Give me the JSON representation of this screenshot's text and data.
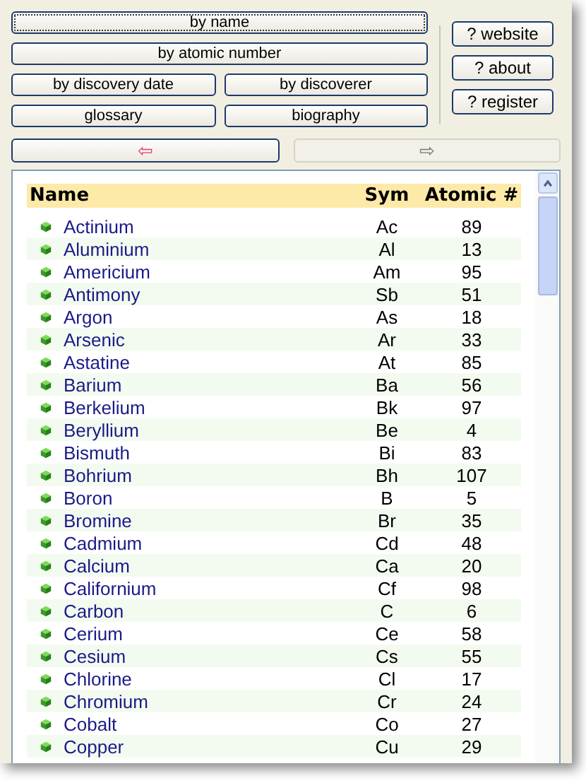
{
  "sort_buttons": [
    {
      "label": "by name",
      "selected": true,
      "wide": true
    },
    {
      "label": "by atomic number",
      "selected": false,
      "wide": true
    },
    {
      "label": "by discovery date",
      "selected": false,
      "wide": false
    },
    {
      "label": "by discoverer",
      "selected": false,
      "wide": false
    },
    {
      "label": "glossary",
      "selected": false,
      "wide": false
    },
    {
      "label": "biography",
      "selected": false,
      "wide": false
    }
  ],
  "help_buttons": [
    "? website",
    "? about",
    "? register"
  ],
  "nav": [
    {
      "label": "⇦",
      "disabled": false
    },
    {
      "label": "⇨",
      "disabled": true
    }
  ],
  "table": {
    "columns": [
      "Name",
      "Sym",
      "Atomic #"
    ],
    "rows": [
      [
        "Actinium",
        "Ac",
        "89"
      ],
      [
        "Aluminium",
        "Al",
        "13"
      ],
      [
        "Americium",
        "Am",
        "95"
      ],
      [
        "Antimony",
        "Sb",
        "51"
      ],
      [
        "Argon",
        "As",
        "18"
      ],
      [
        "Arsenic",
        "Ar",
        "33"
      ],
      [
        "Astatine",
        "At",
        "85"
      ],
      [
        "Barium",
        "Ba",
        "56"
      ],
      [
        "Berkelium",
        "Bk",
        "97"
      ],
      [
        "Beryllium",
        "Be",
        "4"
      ],
      [
        "Bismuth",
        "Bi",
        "83"
      ],
      [
        "Bohrium",
        "Bh",
        "107"
      ],
      [
        "Boron",
        "B",
        "5"
      ],
      [
        "Bromine",
        "Br",
        "35"
      ],
      [
        "Cadmium",
        "Cd",
        "48"
      ],
      [
        "Calcium",
        "Ca",
        "20"
      ],
      [
        "Californium",
        "Cf",
        "98"
      ],
      [
        "Carbon",
        "C",
        "6"
      ],
      [
        "Cerium",
        "Ce",
        "58"
      ],
      [
        "Cesium",
        "Cs",
        "55"
      ],
      [
        "Chlorine",
        "Cl",
        "17"
      ],
      [
        "Chromium",
        "Cr",
        "24"
      ],
      [
        "Cobalt",
        "Co",
        "27"
      ],
      [
        "Copper",
        "Cu",
        "29"
      ]
    ]
  }
}
